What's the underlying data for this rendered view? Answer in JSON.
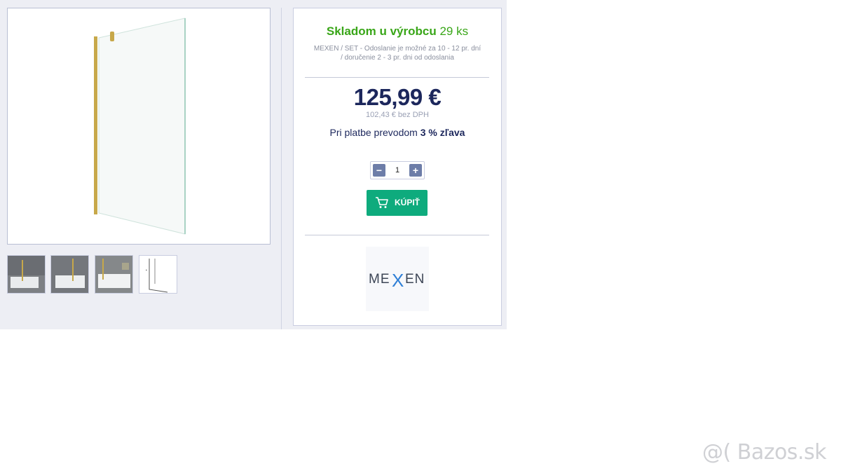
{
  "stock": {
    "label": "Skladom u výrobcu",
    "count": "29 ks"
  },
  "shipping": {
    "text": "MEXEN / SET - Odoslanie je možné za 10 - 12 pr. dní / doručenie 2 - 3 pr. dni od odoslania"
  },
  "price": {
    "main": "125,99 €",
    "without_vat": "102,43 € bez DPH"
  },
  "discount": {
    "prefix": "Pri platbe prevodom",
    "value": "3 % zľava"
  },
  "quantity": {
    "minus": "−",
    "value": "1",
    "plus": "+"
  },
  "buy": {
    "label": "KÚPIŤ",
    "icon": "cart-icon"
  },
  "brand": {
    "logo_text": "MEXEN"
  },
  "watermark": {
    "text": "@( Bazos.sk"
  },
  "colors": {
    "stock_green": "#39a618",
    "price_navy": "#1c275c",
    "buy_green": "#0eab7d",
    "gold_profile": "#c7a84a"
  }
}
